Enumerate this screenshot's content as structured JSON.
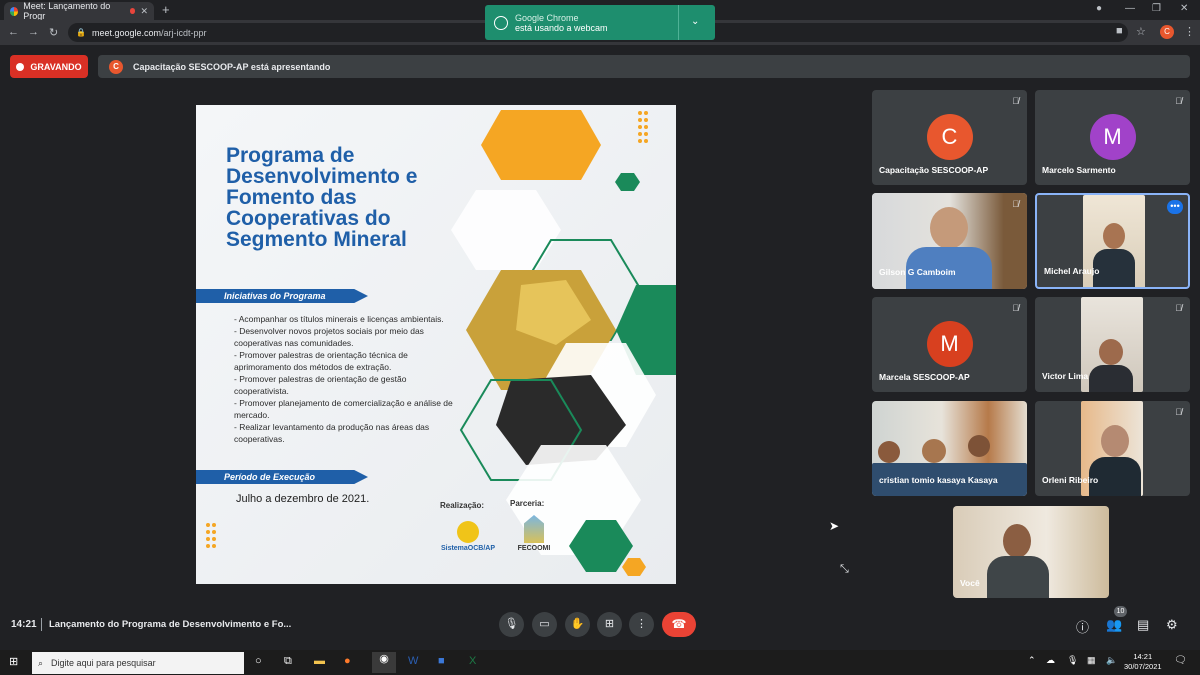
{
  "browser": {
    "tab_title": "Meet: Lançamento do Progr",
    "tab_close": "✕",
    "new_tab": "+",
    "url_host": "meet.google.com",
    "url_path": "/arj-icdt-ppr",
    "profile_initial": "C"
  },
  "chrome_notice": {
    "title": "Google Chrome",
    "message": "está usando a webcam"
  },
  "recording": {
    "label": "GRAVANDO",
    "presenter_initial": "C",
    "presenting_text": "Capacitação SESCOOP-AP está apresentando"
  },
  "slide": {
    "title_lines": [
      "Programa de",
      "Desenvolvimento e",
      "Fomento das",
      "Cooperativas do",
      "Segmento Mineral"
    ],
    "section1": "Iniciativas do Programa",
    "bullets": [
      "- Acompanhar os títulos minerais e licenças ambientais.",
      "- Desenvolver novos projetos sociais por meio das cooperativas nas comunidades.",
      "- Promover palestras de orientação técnica de aprimoramento dos métodos de extração.",
      "- Promover palestras de orientação de gestão cooperativista.",
      "- Promover planejamento de comercialização e análise de mercado.",
      "- Realizar levantamento da produção nas áreas das cooperativas."
    ],
    "section2": "Período de Execução",
    "period": "Julho a dezembro de 2021.",
    "realizacao": "Realização:",
    "parceria": "Parceria:",
    "logo1": "SistemaOCB/AP",
    "logo2": "FECOOMI"
  },
  "participants": [
    {
      "name": "Capacitação SESCOOP-AP",
      "initial": "C",
      "color": "#e8572e",
      "muted": true
    },
    {
      "name": "Marcelo Sarmento",
      "initial": "M",
      "color": "#a142c9",
      "muted": true
    },
    {
      "name": "Gilson G Camboim",
      "muted": true
    },
    {
      "name": "Michel Araujo",
      "muted": false
    },
    {
      "name": "Marcela SESCOOP-AP",
      "initial": "M",
      "color": "#d8401f",
      "muted": true
    },
    {
      "name": "Victor Lima",
      "muted": true
    },
    {
      "name": "cristian tomio kasaya Kasaya",
      "muted": false
    },
    {
      "name": "Orleni Ribeiro",
      "muted": true
    },
    {
      "name": "Você",
      "muted": false
    }
  ],
  "meeting": {
    "time": "14:21",
    "title": "Lançamento do Programa de Desenvolvimento e Fo...",
    "participant_count": "10"
  },
  "taskbar": {
    "search_placeholder": "Digite aqui para pesquisar",
    "time": "14:21",
    "date": "30/07/2021"
  },
  "colors": {
    "accent_green": "#1e8e6e",
    "record_red": "#d93025",
    "slide_blue": "#1f5fa8",
    "hex_orange": "#f5a623",
    "hex_green": "#1a8a5a"
  }
}
